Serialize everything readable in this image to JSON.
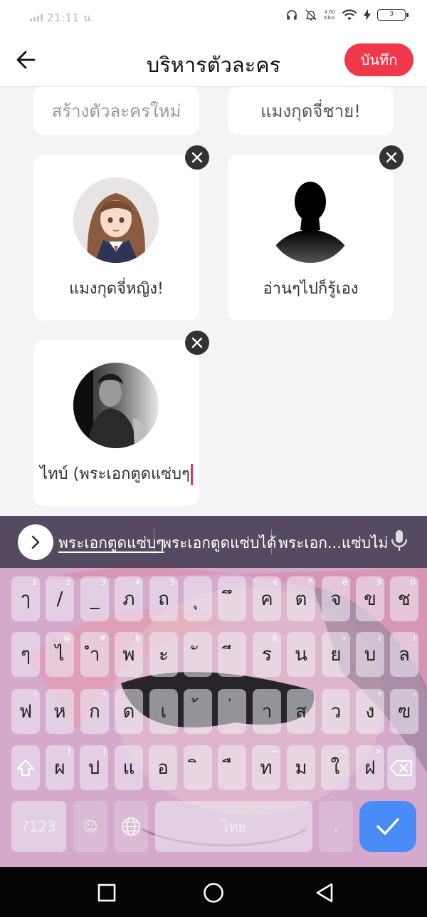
{
  "status": {
    "time": "21:11 น.",
    "net_speed_top": "4.60",
    "net_speed_bottom": "KB/s",
    "battery": "3"
  },
  "header": {
    "title": "บริหารตัวละคร",
    "save_label": "บันทึก",
    "accent": "#f0384a"
  },
  "cards_top": [
    {
      "label": "สร้างตัวละครใหม่"
    },
    {
      "label": "แมงกุดจี่ชาย!"
    }
  ],
  "characters": [
    {
      "name": "แมงกุดจี่หญิง!",
      "avatar": "anime-girl-avatar"
    },
    {
      "name": "อ่านๆไปก็รู้เอง",
      "avatar": "silhouette-avatar"
    },
    {
      "name": "ไทบ์ (พระเอกตูดแซ่บๆ",
      "avatar": "man-portrait-avatar"
    }
  ],
  "keyboard": {
    "suggestions": [
      "พระเอกตูดแซ่บๆ",
      "พระเอกตูดแซ่บได้",
      "พระเอก...แซ่บไม่"
    ],
    "rows": [
      [
        {
          "k": "ๅ",
          "h": "1"
        },
        {
          "k": "/",
          "h": "2"
        },
        {
          "k": "_",
          "h": "3"
        },
        {
          "k": "ภ",
          "h": "4"
        },
        {
          "k": "ถ",
          "h": "5"
        },
        {
          "k": "ุ",
          "h": ""
        },
        {
          "k": "ึ",
          "h": ""
        },
        {
          "k": "ค",
          "h": "6"
        },
        {
          "k": "ต",
          "h": "7"
        },
        {
          "k": "จ",
          "h": "8"
        },
        {
          "k": "ข",
          "h": "9"
        },
        {
          "k": "ช",
          "h": "0"
        }
      ],
      [
        {
          "k": "ๆ",
          "h": ""
        },
        {
          "k": "ไ",
          "h": "@"
        },
        {
          "k": "ำ",
          "h": "#"
        },
        {
          "k": "พ",
          "h": "฿"
        },
        {
          "k": "ะ",
          "h": ""
        },
        {
          "k": "ั",
          "h": ""
        },
        {
          "k": "ี",
          "h": ""
        },
        {
          "k": "ร",
          "h": "&"
        },
        {
          "k": "น",
          "h": ""
        },
        {
          "k": "ย",
          "h": "+"
        },
        {
          "k": "บ",
          "h": "("
        },
        {
          "k": "ล",
          "h": ")"
        }
      ],
      [
        {
          "k": "ฟ",
          "h": "\\"
        },
        {
          "k": "ห",
          "h": ""
        },
        {
          "k": "ก",
          "h": "*"
        },
        {
          "k": "ด",
          "h": ""
        },
        {
          "k": "เ",
          "h": ""
        },
        {
          "k": "้",
          "h": ""
        },
        {
          "k": "่",
          "h": ""
        },
        {
          "k": "า",
          "h": ""
        },
        {
          "k": "ส",
          "h": ""
        },
        {
          "k": "ว",
          "h": ""
        },
        {
          "k": "ง",
          "h": "?"
        },
        {
          "k": "ฃ",
          "h": "/"
        }
      ],
      [
        {
          "k": "ผ",
          "h": "["
        },
        {
          "k": "ป",
          "h": "]"
        },
        {
          "k": "แ",
          "h": ""
        },
        {
          "k": "อ",
          "h": ""
        },
        {
          "k": "ิ",
          "h": ""
        },
        {
          "k": "ื",
          "h": ""
        },
        {
          "k": "ท",
          "h": "~"
        },
        {
          "k": "ม",
          "h": ""
        },
        {
          "k": "ใ",
          "h": "<"
        },
        {
          "k": "ฝ",
          "h": ">"
        }
      ]
    ],
    "symbols_label": "?123",
    "space_label": "ไทย",
    "period_label": ".",
    "emoji_label": "☺"
  }
}
